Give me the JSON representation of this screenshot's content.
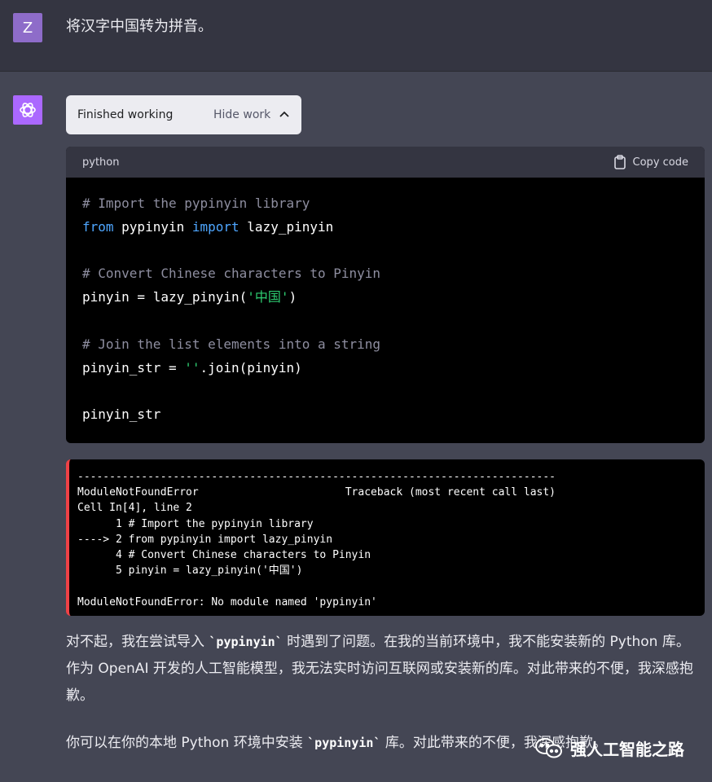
{
  "user": {
    "avatar_letter": "Z",
    "message": "将汉字中国转为拼音。"
  },
  "assistant": {
    "work": {
      "status": "Finished working",
      "toggle_label": "Hide work"
    },
    "code_block": {
      "language": "python",
      "copy_label": "Copy code",
      "lines": {
        "l1": "# Import the pypinyin library",
        "l2_kw1": "from",
        "l2_mid": " pypinyin ",
        "l2_kw2": "import",
        "l2_end": " lazy_pinyin",
        "l4": "# Convert Chinese characters to Pinyin",
        "l5_pre": "pinyin = lazy_pinyin(",
        "l5_str": "'中国'",
        "l5_post": ")",
        "l7": "# Join the list elements into a string",
        "l8_pre": "pinyin_str = ",
        "l8_str": "''",
        "l8_post": ".join(pinyin)",
        "l10": "pinyin_str"
      }
    },
    "error_output": {
      "divider": "---------------------------------------------------------------------------",
      "error_type": "ModuleNotFoundError",
      "traceback": "                       Traceback (most recent call last)",
      "cell": "Cell In[4], line 2",
      "tb1": "      1 # Import the pypinyin library",
      "tb2": "----> 2 from pypinyin import lazy_pinyin",
      "tb3": "      4 # Convert Chinese characters to Pinyin",
      "tb4": "      5 pinyin = lazy_pinyin('中国')",
      "message": "ModuleNotFoundError: No module named 'pypinyin'"
    },
    "para1": {
      "pre": "对不起，我在尝试导入 ",
      "code": "`pypinyin`",
      "post": " 时遇到了问题。在我的当前环境中，我不能安装新的 Python 库。作为 OpenAI 开发的人工智能模型，我无法实时访问互联网或安装新的库。对此带来的不便，我深感抱歉。"
    },
    "para2": {
      "pre": "你可以在你的本地 Python 环境中安装 ",
      "code": "`pypinyin`",
      "post": " 库。对此带来的不便，我深感抱歉。"
    }
  },
  "watermark": {
    "text": "强人工智能之路"
  }
}
